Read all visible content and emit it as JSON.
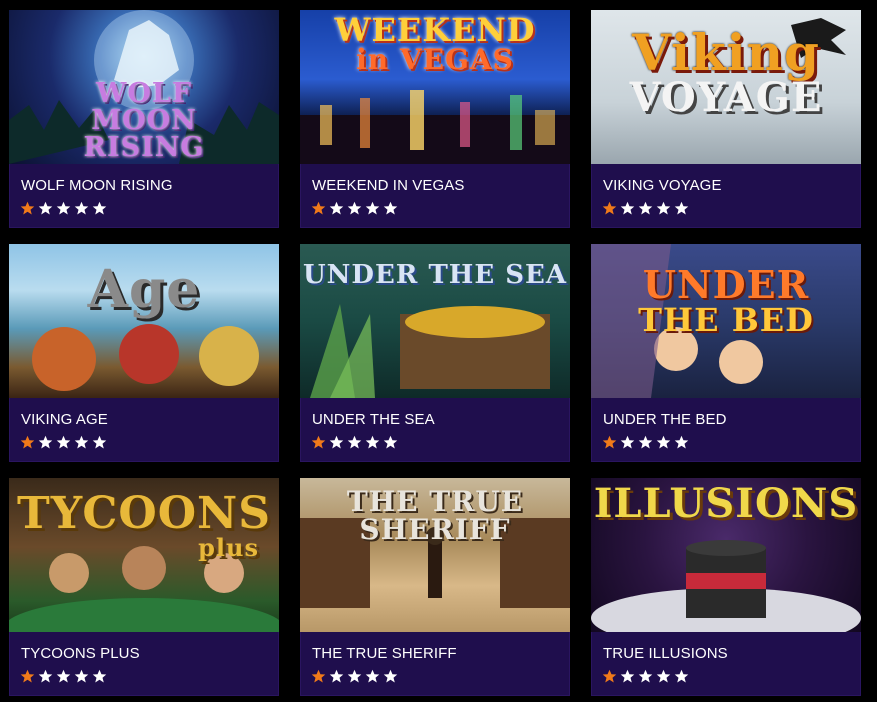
{
  "games": [
    {
      "title": "WOLF MOON RISING",
      "logo_lines": [
        "WOLF",
        "MOON",
        "RISING"
      ],
      "rating": 1,
      "max_rating": 5
    },
    {
      "title": "WEEKEND IN VEGAS",
      "logo_lines": [
        "WEEKEND",
        "in VEGAS"
      ],
      "rating": 1,
      "max_rating": 5
    },
    {
      "title": "VIKING VOYAGE",
      "logo_lines": [
        "Viking",
        "VOYAGE"
      ],
      "rating": 1,
      "max_rating": 5
    },
    {
      "title": "VIKING AGE",
      "logo_lines": [
        "Age"
      ],
      "rating": 1,
      "max_rating": 5
    },
    {
      "title": "UNDER THE SEA",
      "logo_lines": [
        "UNDER THE SEA"
      ],
      "rating": 1,
      "max_rating": 5
    },
    {
      "title": "UNDER THE BED",
      "logo_lines": [
        "UNDER",
        "THE BED"
      ],
      "rating": 1,
      "max_rating": 5
    },
    {
      "title": "TYCOONS PLUS",
      "logo_lines": [
        "TYCOONS",
        "plus"
      ],
      "rating": 1,
      "max_rating": 5
    },
    {
      "title": "THE TRUE SHERIFF",
      "logo_lines": [
        "THE TRUE SHERIFF"
      ],
      "rating": 1,
      "max_rating": 5
    },
    {
      "title": "TRUE ILLUSIONS",
      "logo_lines": [
        "ILLUSIONS"
      ],
      "rating": 1,
      "max_rating": 5
    }
  ],
  "colors": {
    "card_bg": "#1f0e4d",
    "page_bg": "#000000",
    "star_filled": "#f07a1a",
    "star_empty": "#ffffff"
  },
  "icons": {
    "star": "star-icon"
  }
}
